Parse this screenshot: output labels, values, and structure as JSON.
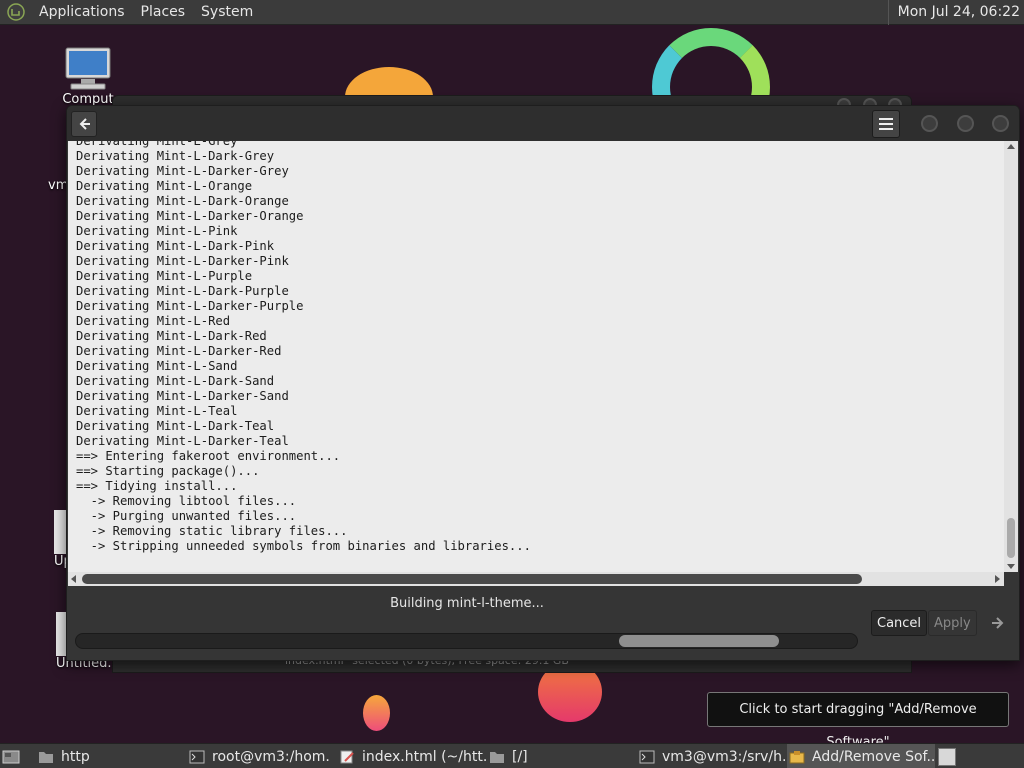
{
  "top_panel": {
    "menu": [
      "Applications",
      "Places",
      "System"
    ],
    "clock": "Mon Jul 24, 06:22"
  },
  "desktop": {
    "icons": [
      {
        "label": "Comput",
        "icon": "computer-icon"
      },
      {
        "label": "vm",
        "icon": "folder-icon"
      },
      {
        "label": "Up",
        "icon": "file-icon"
      },
      {
        "label": "Untitled.",
        "icon": "file-icon"
      }
    ]
  },
  "background_window": {
    "status": "index.html\" selected (0 bytes), Free space: 29.1 GB"
  },
  "main_window": {
    "terminal_lines": [
      "Derivating Mint-L-Grey",
      "Derivating Mint-L-Dark-Grey",
      "Derivating Mint-L-Darker-Grey",
      "Derivating Mint-L-Orange",
      "Derivating Mint-L-Dark-Orange",
      "Derivating Mint-L-Darker-Orange",
      "Derivating Mint-L-Pink",
      "Derivating Mint-L-Dark-Pink",
      "Derivating Mint-L-Darker-Pink",
      "Derivating Mint-L-Purple",
      "Derivating Mint-L-Dark-Purple",
      "Derivating Mint-L-Darker-Purple",
      "Derivating Mint-L-Red",
      "Derivating Mint-L-Dark-Red",
      "Derivating Mint-L-Darker-Red",
      "Derivating Mint-L-Sand",
      "Derivating Mint-L-Dark-Sand",
      "Derivating Mint-L-Darker-Sand",
      "Derivating Mint-L-Teal",
      "Derivating Mint-L-Dark-Teal",
      "Derivating Mint-L-Darker-Teal",
      "==> Entering fakeroot environment...",
      "==> Starting package()...",
      "==> Tidying install...",
      "  -> Removing libtool files...",
      "  -> Purging unwanted files...",
      "  -> Removing static library files...",
      "  -> Stripping unneeded symbols from binaries and libraries..."
    ],
    "status_text": "Building mint-l-theme...",
    "cancel_label": "Cancel",
    "apply_label": "Apply"
  },
  "tooltip": "Click to start dragging \"Add/Remove Software\"",
  "taskbar": {
    "items": [
      {
        "label": "http",
        "icon": "folder-icon"
      },
      {
        "label": "root@vm3:/hom...",
        "icon": "terminal-icon"
      },
      {
        "label": "index.html (~/htt...",
        "icon": "text-editor-icon"
      },
      {
        "label": "[/]",
        "icon": "folder-icon"
      },
      {
        "label": "vm3@vm3:/srv/h...",
        "icon": "terminal-icon"
      },
      {
        "label": "Add/Remove Sof...",
        "icon": "software-icon"
      }
    ]
  },
  "colors": {
    "desktop_bg": "#2a1526",
    "panel_bg": "#3b3b3b",
    "terminal_bg": "#ececec",
    "terminal_text": "#1c1c1c"
  }
}
